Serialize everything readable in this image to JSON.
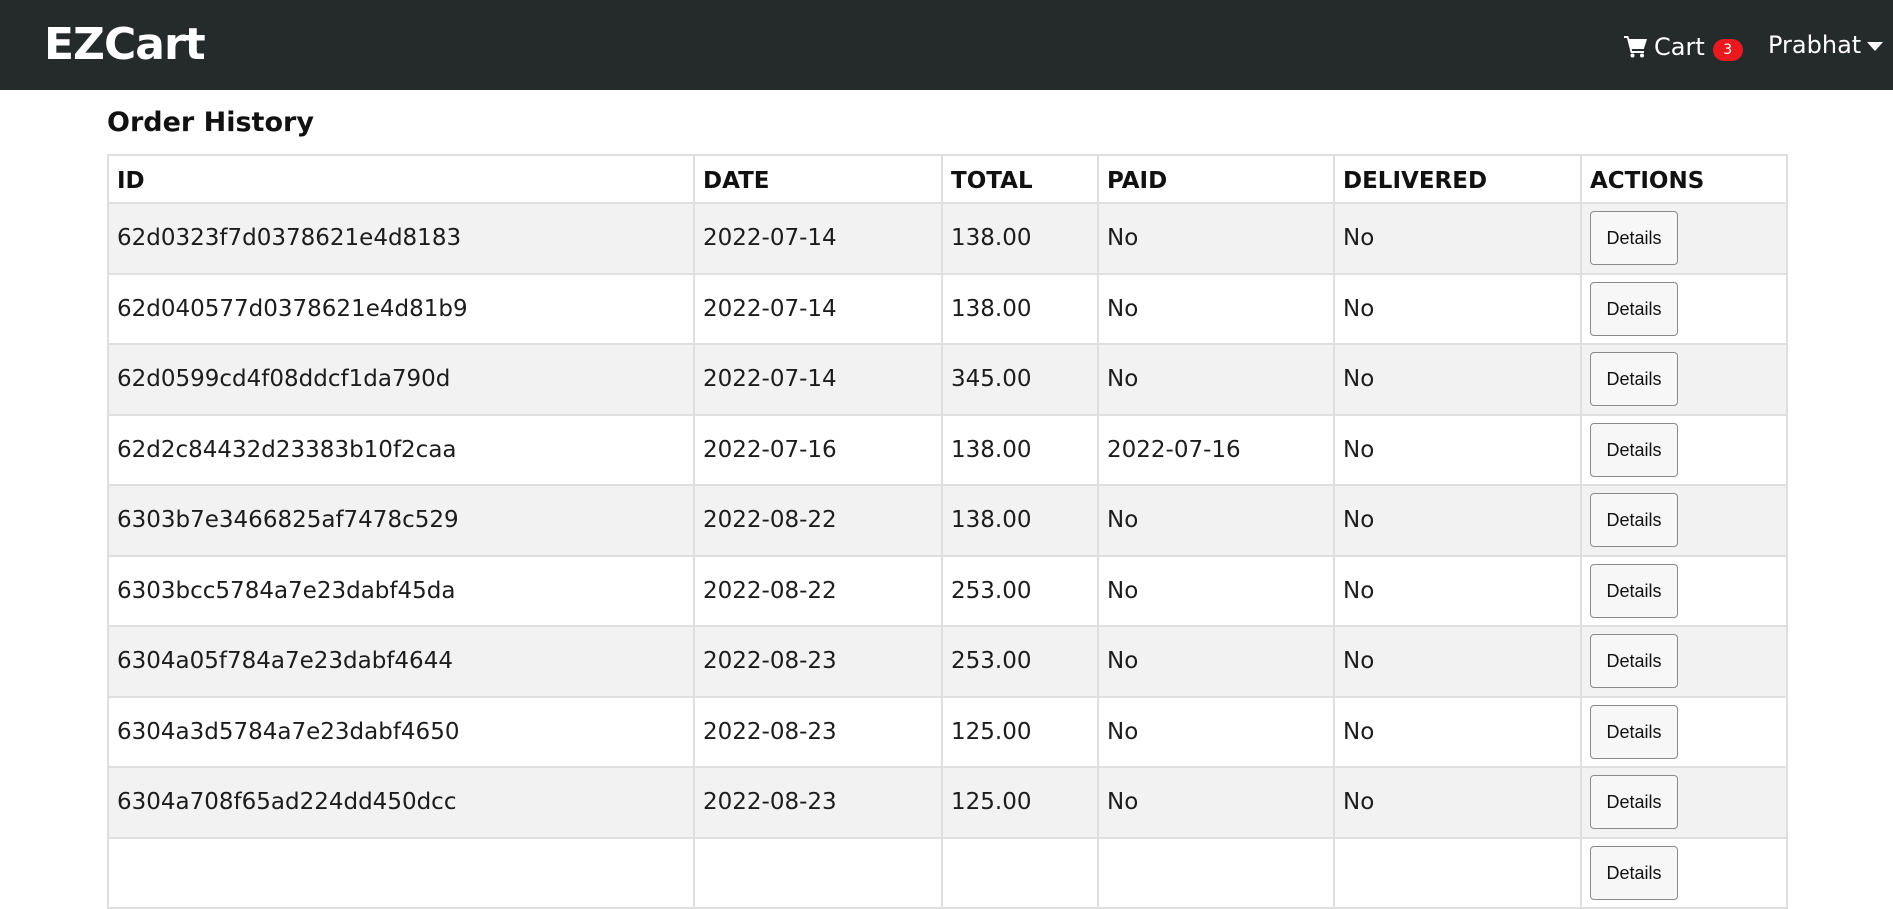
{
  "navbar": {
    "brand": "EZCart",
    "cart_label": "Cart",
    "cart_count": "3",
    "user_name": "Prabhat",
    "cart_icon": "shopping-cart-icon",
    "caret_icon": "caret-down-icon"
  },
  "page_title": "Order History",
  "table": {
    "headers": [
      "ID",
      "DATE",
      "TOTAL",
      "PAID",
      "DELIVERED",
      "ACTIONS"
    ],
    "rows": [
      {
        "id": "62d0323f7d0378621e4d8183",
        "date": "2022-07-14",
        "total": "138.00",
        "paid": "No",
        "delivered": "No",
        "action": "Details"
      },
      {
        "id": "62d040577d0378621e4d81b9",
        "date": "2022-07-14",
        "total": "138.00",
        "paid": "No",
        "delivered": "No",
        "action": "Details"
      },
      {
        "id": "62d0599cd4f08ddcf1da790d",
        "date": "2022-07-14",
        "total": "345.00",
        "paid": "No",
        "delivered": "No",
        "action": "Details"
      },
      {
        "id": "62d2c84432d23383b10f2caa",
        "date": "2022-07-16",
        "total": "138.00",
        "paid": "2022-07-16",
        "delivered": "No",
        "action": "Details"
      },
      {
        "id": "6303b7e3466825af7478c529",
        "date": "2022-08-22",
        "total": "138.00",
        "paid": "No",
        "delivered": "No",
        "action": "Details"
      },
      {
        "id": "6303bcc5784a7e23dabf45da",
        "date": "2022-08-22",
        "total": "253.00",
        "paid": "No",
        "delivered": "No",
        "action": "Details"
      },
      {
        "id": "6304a05f784a7e23dabf4644",
        "date": "2022-08-23",
        "total": "253.00",
        "paid": "No",
        "delivered": "No",
        "action": "Details"
      },
      {
        "id": "6304a3d5784a7e23dabf4650",
        "date": "2022-08-23",
        "total": "125.00",
        "paid": "No",
        "delivered": "No",
        "action": "Details"
      },
      {
        "id": "6304a708f65ad224dd450dcc",
        "date": "2022-08-23",
        "total": "125.00",
        "paid": "No",
        "delivered": "No",
        "action": "Details"
      },
      {
        "id": "",
        "date": "",
        "total": "",
        "paid": "",
        "delivered": "",
        "action": "Details"
      }
    ]
  }
}
